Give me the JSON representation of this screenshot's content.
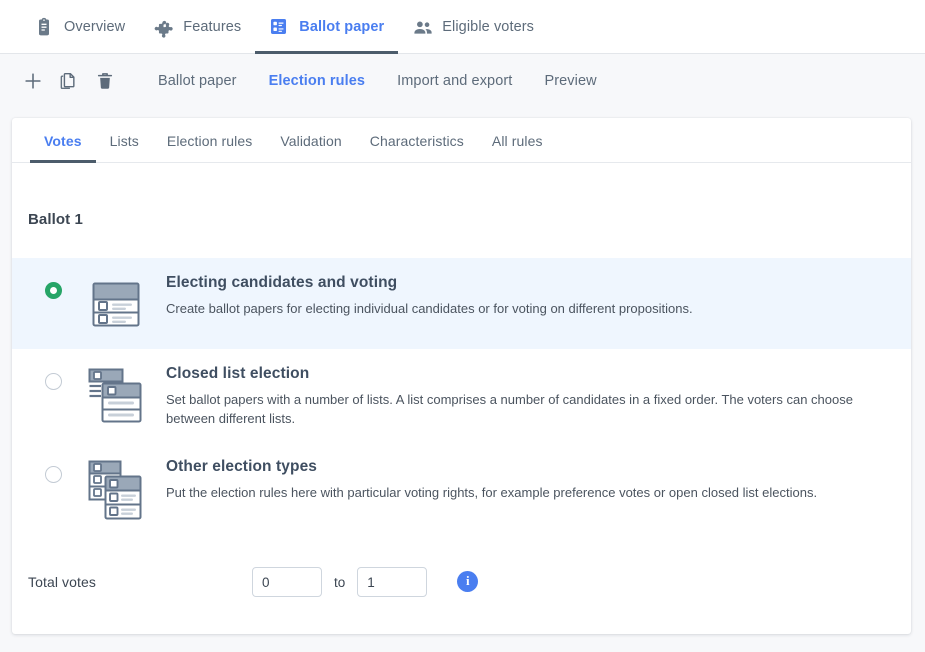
{
  "colors": {
    "accent_blue": "#4a7ef0",
    "active_underline": "#4c5c6b",
    "selected_radio_green": "#27a567",
    "selected_row_bg": "#eff6fe",
    "muted_text": "#5d6b7a",
    "page_bg": "#f7f8fa",
    "icon_slate": "#63748a"
  },
  "topnav": {
    "items": [
      {
        "label": "Overview",
        "icon": "clipboard-icon",
        "active": false
      },
      {
        "label": "Features",
        "icon": "puzzle-piece-icon",
        "active": false
      },
      {
        "label": "Ballot paper",
        "icon": "ballot-paper-icon",
        "active": true
      },
      {
        "label": "Eligible voters",
        "icon": "people-icon",
        "active": false
      }
    ]
  },
  "toolbar": {
    "buttons": [
      {
        "name": "add-button",
        "icon": "plus-icon"
      },
      {
        "name": "duplicate-button",
        "icon": "copy-icon"
      },
      {
        "name": "delete-button",
        "icon": "trash-icon"
      }
    ],
    "links": [
      {
        "label": "Ballot paper",
        "active": false
      },
      {
        "label": "Election rules",
        "active": true
      },
      {
        "label": "Import and export",
        "active": false
      },
      {
        "label": "Preview",
        "active": false
      }
    ]
  },
  "card": {
    "tabs": [
      {
        "label": "Votes",
        "active": true
      },
      {
        "label": "Lists",
        "active": false
      },
      {
        "label": "Election rules",
        "active": false
      },
      {
        "label": "Validation",
        "active": false
      },
      {
        "label": "Characteristics",
        "active": false
      },
      {
        "label": "All rules",
        "active": false
      }
    ],
    "ballot_title": "Ballot 1",
    "options": [
      {
        "title": "Electing candidates and voting",
        "desc": "Create ballot papers for electing individual candidates or for voting on different propositions.",
        "icon": "single-ballot-icon",
        "selected": true
      },
      {
        "title": "Closed list election",
        "desc": "Set ballot papers with a number of lists. A list comprises a number of candidates in a fixed order. The voters can choose between different lists.",
        "icon": "stacked-ballot-icon",
        "selected": false
      },
      {
        "title": "Other election types",
        "desc": "Put the election rules here with particular voting rights, for example preference votes or open closed list elections.",
        "icon": "multi-ballot-icon",
        "selected": false
      }
    ],
    "totals": {
      "label": "Total votes",
      "min_value": "0",
      "min_placeholder": "0",
      "to_label": "to",
      "max_value": "1",
      "max_placeholder": "1",
      "info_glyph": "i"
    }
  }
}
